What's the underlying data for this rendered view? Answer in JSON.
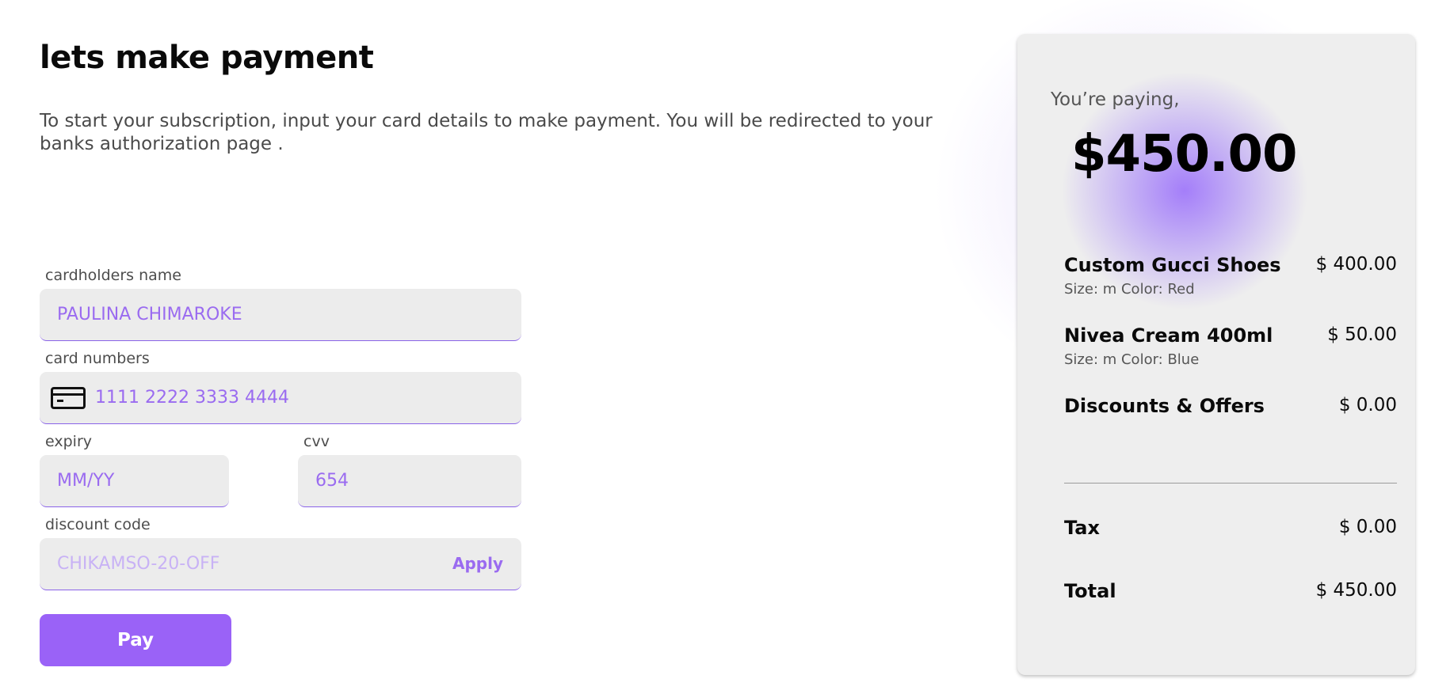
{
  "header": {
    "title": "lets make payment",
    "subtitle": "To start your subscription, input your card details to make payment. You will be redirected to your banks authorization page ."
  },
  "form": {
    "cardholder": {
      "label": "cardholders name",
      "placeholder": "PAULINA CHIMAROKE"
    },
    "card_number": {
      "label": "card numbers",
      "placeholder": "1111 2222 3333 4444",
      "icon": "credit-card-icon"
    },
    "expiry": {
      "label": "expiry",
      "placeholder": "MM/YY"
    },
    "cvv": {
      "label": "cvv",
      "placeholder": "654"
    },
    "discount": {
      "label": "discount code",
      "placeholder": "CHIKAMSO-20-OFF",
      "apply_label": "Apply"
    },
    "pay_label": "Pay"
  },
  "summary": {
    "paying_label": "You’re paying,",
    "amount": "$450.00",
    "items": [
      {
        "name": "Custom Gucci Shoes",
        "meta": "Size: m Color: Red",
        "price": "$ 400.00"
      },
      {
        "name": "Nivea Cream 400ml",
        "meta": "Size: m Color: Blue",
        "price": "$ 50.00"
      },
      {
        "name": "Discounts & Offers",
        "meta": "",
        "price": "$ 0.00"
      }
    ],
    "tax": {
      "label": "Tax",
      "value": "$ 0.00"
    },
    "total": {
      "label": "Total",
      "value": "$ 450.00"
    }
  },
  "colors": {
    "accent": "#9a62f7",
    "input_text": "#9a6bf0",
    "input_bg": "#ececec",
    "card_bg": "#eeeeee"
  }
}
